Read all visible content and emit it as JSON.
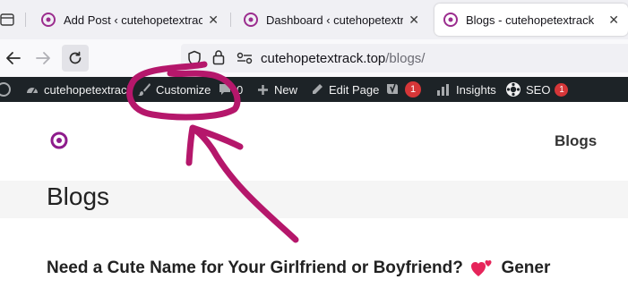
{
  "browser": {
    "tabs": [
      {
        "title": "Add Post ‹ cutehopetextrack —",
        "close": "✕",
        "active": false
      },
      {
        "title": "Dashboard ‹ cutehopetextrack -",
        "close": "✕",
        "active": false
      },
      {
        "title": "Blogs - cutehopetextrack",
        "close": "✕",
        "active": true
      }
    ],
    "url": {
      "domain": "cutehopetextrack.top",
      "path": "/blogs/"
    }
  },
  "admin_bar": {
    "site_name": "cutehopetextrack",
    "customize": "Customize",
    "comments_count": "0",
    "new": "New",
    "edit_page": "Edit Page",
    "yoast_badge": "1",
    "insights": "Insights",
    "seo": "SEO",
    "seo_badge": "1"
  },
  "site": {
    "nav_link": "Blogs",
    "page_title": "Blogs",
    "post_title_start": "Need a Cute Name for Your Girlfriend or Boyfriend?",
    "post_title_end": "Gener"
  },
  "colors": {
    "tab_favicon": "#9b2d8e",
    "admin_bar": "#1d2327",
    "badge": "#d63638",
    "annotation": "#b5176b",
    "logo": "#8e1c8c",
    "heart": "#e6245a"
  }
}
